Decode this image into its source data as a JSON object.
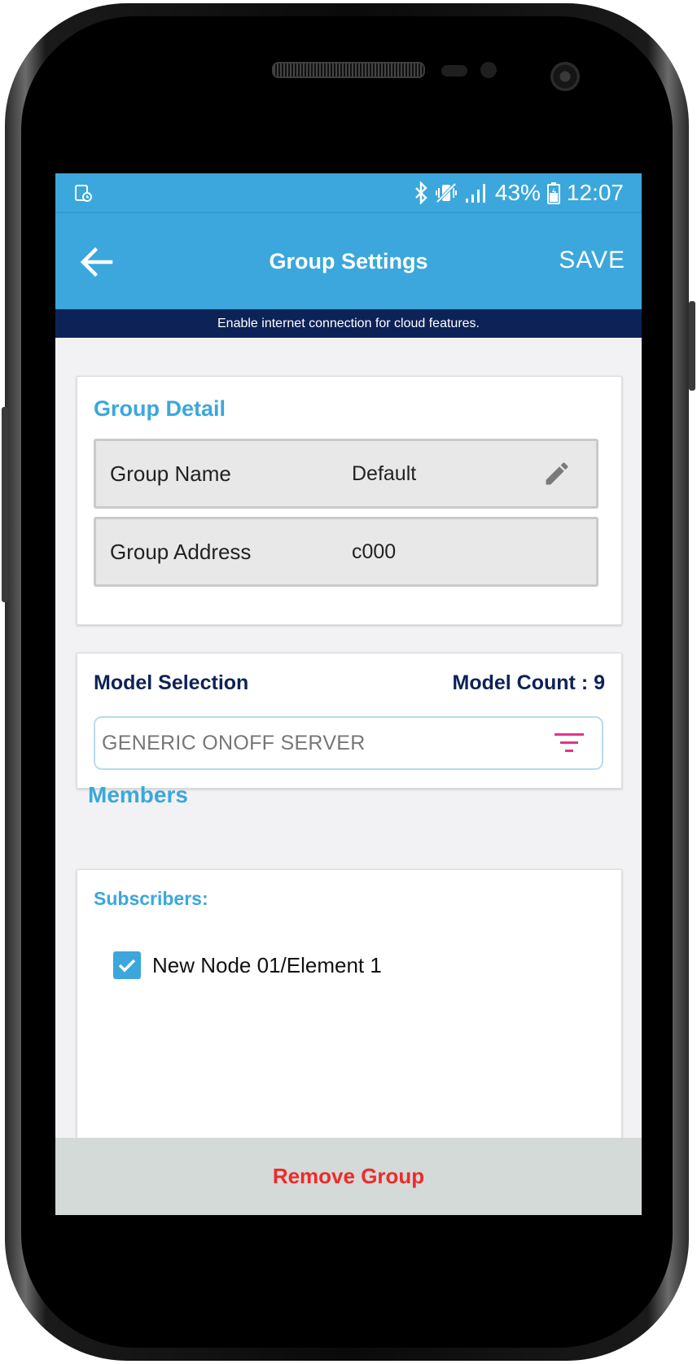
{
  "status_bar": {
    "battery_percent": "43%",
    "time": "12:07",
    "icons": [
      "notification-icon",
      "bluetooth-icon",
      "vibrate-icon",
      "signal-icon",
      "battery-icon"
    ]
  },
  "app_bar": {
    "title": "Group Settings",
    "save_label": "SAVE",
    "back_icon": "arrow-left-icon"
  },
  "banner": {
    "text": "Enable internet connection for cloud features."
  },
  "group_detail": {
    "section_title": "Group Detail",
    "rows": [
      {
        "label": "Group Name",
        "value": "Default",
        "icon": "pencil-icon"
      },
      {
        "label": "Group Address",
        "value": "c000"
      }
    ]
  },
  "model_selection": {
    "title": "Model Selection",
    "count_label": "Model Count : 9",
    "selected_value": "GENERIC ONOFF SERVER",
    "filter_icon": "filter-icon"
  },
  "members": {
    "title": "Members",
    "subscribers_title": "Subscribers:",
    "subscribers": [
      {
        "name": "New Node 01/Element 1",
        "checked": true
      }
    ]
  },
  "footer": {
    "remove_label": "Remove Group"
  },
  "colors": {
    "primary": "#3ba7dc",
    "banner_bg": "#0d2256",
    "heading_dark": "#0d2256",
    "remove_text": "#ee2a2a",
    "filter_icon": "#e0358a"
  }
}
